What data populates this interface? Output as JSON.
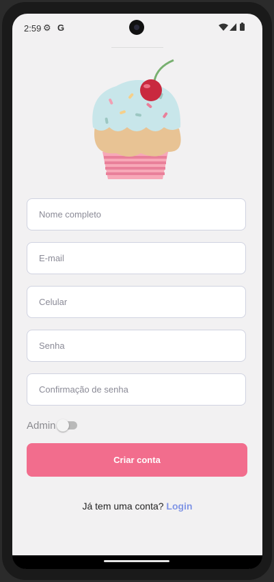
{
  "status": {
    "time": "2:59"
  },
  "form": {
    "name_placeholder": "Nome completo",
    "email_placeholder": "E-mail",
    "phone_placeholder": "Celular",
    "password_placeholder": "Senha",
    "confirm_placeholder": "Confirmação de senha"
  },
  "admin": {
    "label": "Admin",
    "enabled": false
  },
  "actions": {
    "create_label": "Criar conta"
  },
  "footer": {
    "prompt": "Já tem uma conta?",
    "login_label": "Login"
  },
  "colors": {
    "primary": "#f26d8d",
    "link": "#8095e5",
    "background": "#f2f1f2"
  }
}
